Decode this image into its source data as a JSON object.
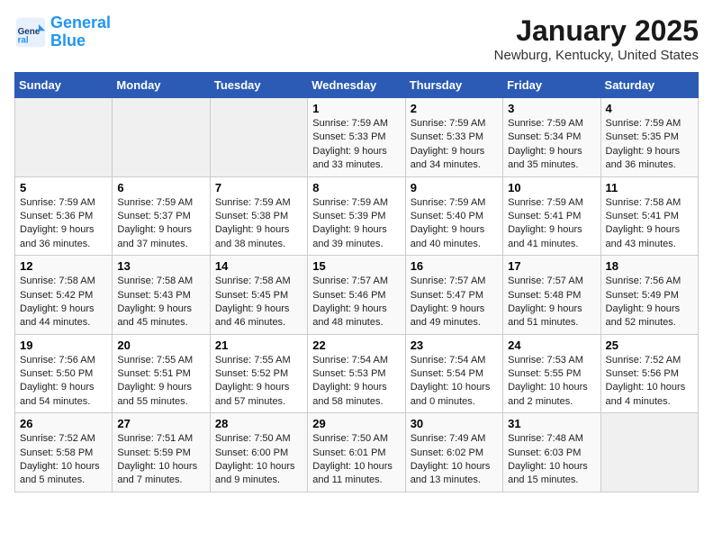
{
  "logo": {
    "name_part1": "General",
    "name_part2": "Blue"
  },
  "title": "January 2025",
  "subtitle": "Newburg, Kentucky, United States",
  "headers": [
    "Sunday",
    "Monday",
    "Tuesday",
    "Wednesday",
    "Thursday",
    "Friday",
    "Saturday"
  ],
  "weeks": [
    [
      {
        "day": "",
        "info": ""
      },
      {
        "day": "",
        "info": ""
      },
      {
        "day": "",
        "info": ""
      },
      {
        "day": "1",
        "info": "Sunrise: 7:59 AM\nSunset: 5:33 PM\nDaylight: 9 hours\nand 33 minutes."
      },
      {
        "day": "2",
        "info": "Sunrise: 7:59 AM\nSunset: 5:33 PM\nDaylight: 9 hours\nand 34 minutes."
      },
      {
        "day": "3",
        "info": "Sunrise: 7:59 AM\nSunset: 5:34 PM\nDaylight: 9 hours\nand 35 minutes."
      },
      {
        "day": "4",
        "info": "Sunrise: 7:59 AM\nSunset: 5:35 PM\nDaylight: 9 hours\nand 36 minutes."
      }
    ],
    [
      {
        "day": "5",
        "info": "Sunrise: 7:59 AM\nSunset: 5:36 PM\nDaylight: 9 hours\nand 36 minutes."
      },
      {
        "day": "6",
        "info": "Sunrise: 7:59 AM\nSunset: 5:37 PM\nDaylight: 9 hours\nand 37 minutes."
      },
      {
        "day": "7",
        "info": "Sunrise: 7:59 AM\nSunset: 5:38 PM\nDaylight: 9 hours\nand 38 minutes."
      },
      {
        "day": "8",
        "info": "Sunrise: 7:59 AM\nSunset: 5:39 PM\nDaylight: 9 hours\nand 39 minutes."
      },
      {
        "day": "9",
        "info": "Sunrise: 7:59 AM\nSunset: 5:40 PM\nDaylight: 9 hours\nand 40 minutes."
      },
      {
        "day": "10",
        "info": "Sunrise: 7:59 AM\nSunset: 5:41 PM\nDaylight: 9 hours\nand 41 minutes."
      },
      {
        "day": "11",
        "info": "Sunrise: 7:58 AM\nSunset: 5:41 PM\nDaylight: 9 hours\nand 43 minutes."
      }
    ],
    [
      {
        "day": "12",
        "info": "Sunrise: 7:58 AM\nSunset: 5:42 PM\nDaylight: 9 hours\nand 44 minutes."
      },
      {
        "day": "13",
        "info": "Sunrise: 7:58 AM\nSunset: 5:43 PM\nDaylight: 9 hours\nand 45 minutes."
      },
      {
        "day": "14",
        "info": "Sunrise: 7:58 AM\nSunset: 5:45 PM\nDaylight: 9 hours\nand 46 minutes."
      },
      {
        "day": "15",
        "info": "Sunrise: 7:57 AM\nSunset: 5:46 PM\nDaylight: 9 hours\nand 48 minutes."
      },
      {
        "day": "16",
        "info": "Sunrise: 7:57 AM\nSunset: 5:47 PM\nDaylight: 9 hours\nand 49 minutes."
      },
      {
        "day": "17",
        "info": "Sunrise: 7:57 AM\nSunset: 5:48 PM\nDaylight: 9 hours\nand 51 minutes."
      },
      {
        "day": "18",
        "info": "Sunrise: 7:56 AM\nSunset: 5:49 PM\nDaylight: 9 hours\nand 52 minutes."
      }
    ],
    [
      {
        "day": "19",
        "info": "Sunrise: 7:56 AM\nSunset: 5:50 PM\nDaylight: 9 hours\nand 54 minutes."
      },
      {
        "day": "20",
        "info": "Sunrise: 7:55 AM\nSunset: 5:51 PM\nDaylight: 9 hours\nand 55 minutes."
      },
      {
        "day": "21",
        "info": "Sunrise: 7:55 AM\nSunset: 5:52 PM\nDaylight: 9 hours\nand 57 minutes."
      },
      {
        "day": "22",
        "info": "Sunrise: 7:54 AM\nSunset: 5:53 PM\nDaylight: 9 hours\nand 58 minutes."
      },
      {
        "day": "23",
        "info": "Sunrise: 7:54 AM\nSunset: 5:54 PM\nDaylight: 10 hours\nand 0 minutes."
      },
      {
        "day": "24",
        "info": "Sunrise: 7:53 AM\nSunset: 5:55 PM\nDaylight: 10 hours\nand 2 minutes."
      },
      {
        "day": "25",
        "info": "Sunrise: 7:52 AM\nSunset: 5:56 PM\nDaylight: 10 hours\nand 4 minutes."
      }
    ],
    [
      {
        "day": "26",
        "info": "Sunrise: 7:52 AM\nSunset: 5:58 PM\nDaylight: 10 hours\nand 5 minutes."
      },
      {
        "day": "27",
        "info": "Sunrise: 7:51 AM\nSunset: 5:59 PM\nDaylight: 10 hours\nand 7 minutes."
      },
      {
        "day": "28",
        "info": "Sunrise: 7:50 AM\nSunset: 6:00 PM\nDaylight: 10 hours\nand 9 minutes."
      },
      {
        "day": "29",
        "info": "Sunrise: 7:50 AM\nSunset: 6:01 PM\nDaylight: 10 hours\nand 11 minutes."
      },
      {
        "day": "30",
        "info": "Sunrise: 7:49 AM\nSunset: 6:02 PM\nDaylight: 10 hours\nand 13 minutes."
      },
      {
        "day": "31",
        "info": "Sunrise: 7:48 AM\nSunset: 6:03 PM\nDaylight: 10 hours\nand 15 minutes."
      },
      {
        "day": "",
        "info": ""
      }
    ]
  ]
}
